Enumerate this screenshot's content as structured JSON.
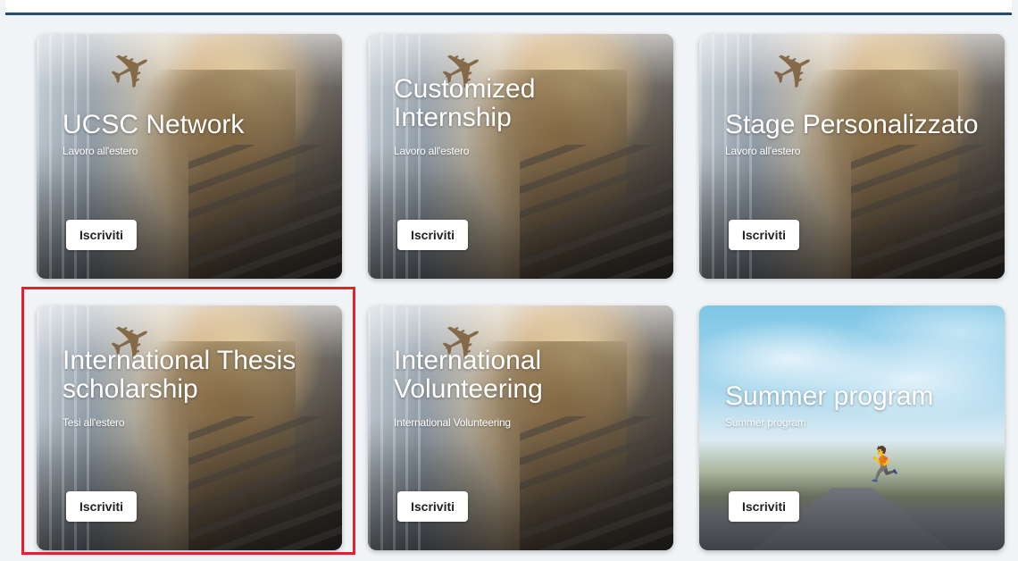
{
  "cards": [
    {
      "title": "UCSC Network",
      "subtitle": "Lavoro all'estero",
      "button_label": "Iscriviti",
      "image": "airport-traveler"
    },
    {
      "title": "Customized Internship",
      "subtitle": "Lavoro all'estero",
      "button_label": "Iscriviti",
      "image": "airport-traveler"
    },
    {
      "title": "Stage Personalizzato",
      "subtitle": "Lavoro all'estero",
      "button_label": "Iscriviti",
      "image": "airport-traveler"
    },
    {
      "title": "International Thesis scholarship",
      "subtitle": "Tesi all'estero",
      "button_label": "Iscriviti",
      "image": "airport-traveler"
    },
    {
      "title": "International Volunteering",
      "subtitle": "International Volunteering",
      "button_label": "Iscriviti",
      "image": "airport-traveler"
    },
    {
      "title": "Summer program",
      "subtitle": "Summer program",
      "button_label": "Iscriviti",
      "image": "road-jumper"
    }
  ],
  "colors": {
    "highlight_border": "#e3222b",
    "header_rule": "#1f4e7a",
    "page_background": "#f1f4f7"
  }
}
